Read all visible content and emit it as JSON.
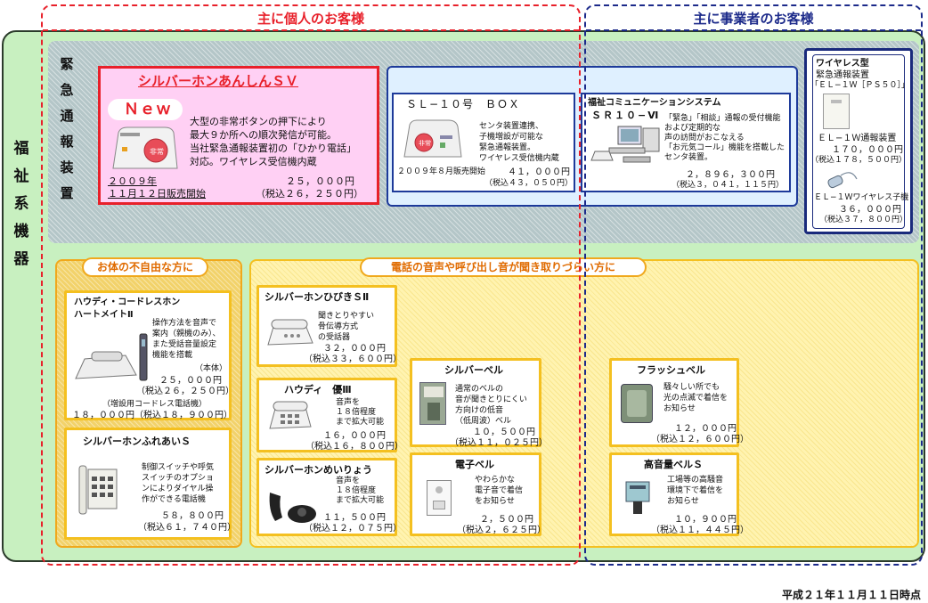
{
  "vertical_title": [
    "福",
    "祉",
    "系",
    "機",
    "器"
  ],
  "individual_header": "主に個人のお客様",
  "business_header": "主に事業者のお客様",
  "emergency_label": [
    "緊",
    "急",
    "通",
    "報",
    "装",
    "置"
  ],
  "sv": {
    "title": "シルバーホンあんしんＳＶ",
    "new_badge": "Ｎｅｗ",
    "desc": [
      "大型の非常ボタンの押下により",
      "最大９か所への順次発信が可能。",
      "当社緊急通報装置初の「ひかり電話」",
      "対応。ワイヤレス受信機内蔵"
    ],
    "button_label": "非常",
    "launch_year": "２００９年",
    "launch_date": "１１月１２日販売開始",
    "price": "２５，０００円",
    "price_tax": "（税込２６，２５０円）"
  },
  "sl10": {
    "title": "ＳＬ−１０号　ＢＯＸ",
    "desc": [
      "センタ装置連携、",
      "子機増設が可能な",
      "緊急通報装置。",
      "ワイヤレス受信機内蔵"
    ],
    "button_label": "非常",
    "launch": "２００９年８月販売開始",
    "price": "４１，０００円",
    "price_tax": "（税込４３，０５０円）"
  },
  "sr10": {
    "title1": "福祉コミュニケーションシステム",
    "title2": "ＳＲ１０−Ⅵ",
    "desc": [
      "「緊急」「相談」通報の受付機能",
      "および定期的な",
      "声の訪問がおこなえる",
      "「お元気コール」機能を搭載した",
      "センタ装置。"
    ],
    "price": "２，８９６，３００円",
    "price_tax": "（税込３，０４１，１１５円）"
  },
  "wireless": {
    "title1": "ワイヤレス型",
    "title2": "緊急通報装置",
    "model": "「ＥＬ−１Ｗ［ＰＳ５０］」",
    "unit_name": "ＥＬ−１Ｗ通報装置",
    "unit_price": "１７０，０００円",
    "unit_price_tax": "（税込１７８，５００円）",
    "sub_name": "ＥＬ−１Ｗワイヤレス子機",
    "sub_price": "３６，０００円",
    "sub_price_tax": "（税込３７，８００円）"
  },
  "disabled_pill": "お体の不自由な方に",
  "hearing_pill": "電話の音声や呼び出し音が聞き取りづらい方に",
  "houdy_cordless": {
    "title1": "ハウディ・コードレスホン",
    "title2": "ハートメイトⅡ",
    "desc": [
      "操作方法を音声で",
      "案内（親機のみ）、",
      "また受話音量設定",
      "機能を搭載"
    ],
    "body_label": "（本体）",
    "price": "２５，０００円",
    "price_tax": "（税込２６，２５０円）",
    "ext_label": "（増設用コードレス電話機）",
    "ext_price": "１８，０００円（税込１８，９００円）"
  },
  "fureai": {
    "title": "シルバーホンふれあいＳ",
    "desc": [
      "制御スイッチや呼気",
      "スイッチのオプショ",
      "ンによりダイヤル操",
      "作ができる電話機"
    ],
    "price": "５８，８００円",
    "price_tax": "（税込６１，７４０円）"
  },
  "hibiki": {
    "title": "シルバーホンひびきＳⅡ",
    "desc": [
      "聞きとりやすい",
      "骨伝導方式",
      "の受話器"
    ],
    "price": "３２，０００円",
    "price_tax": "（税込３３，６００円）"
  },
  "yu3": {
    "title": "ハウディ　優Ⅲ",
    "desc": [
      "音声を",
      "１８倍程度",
      "まで拡大可能"
    ],
    "price": "１６，０００円",
    "price_tax": "（税込１６，８００円）"
  },
  "meiryou": {
    "title": "シルバーホンめいりょう",
    "desc": [
      "音声を",
      "１８倍程度",
      "まで拡大可能"
    ],
    "price": "１１，５００円",
    "price_tax": "（税込１２，０７５円）"
  },
  "silverbell": {
    "title": "シルバーベル",
    "desc": [
      "通常のベルの",
      "音が聞きとりにくい",
      "方向けの低音",
      "（低周波）ベル"
    ],
    "price": "１０，５００円",
    "price_tax": "（税込１１，０２５円）"
  },
  "denshibell": {
    "title": "電子ベル",
    "desc": [
      "やわらかな",
      "電子音で着信",
      "をお知らせ"
    ],
    "price": "２，５００円",
    "price_tax": "（税込２，６２５円）"
  },
  "flashbell": {
    "title": "フラッシュベル",
    "desc": [
      "騒々しい所でも",
      "光の点滅で着信を",
      "お知らせ"
    ],
    "price": "１２，０００円",
    "price_tax": "（税込１２，６００円）"
  },
  "loudbell": {
    "title": "高音量ベルＳ",
    "desc": [
      "工場等の高騒音",
      "環境下で着信を",
      "お知らせ"
    ],
    "price": "１０，９００円",
    "price_tax": "（税込１１，４４５円）"
  },
  "footer": "平成２１年１１月１１日時点",
  "colors": {
    "individual": "#e8202a",
    "business": "#1c2a8a",
    "panel": "#c8f0c0"
  }
}
